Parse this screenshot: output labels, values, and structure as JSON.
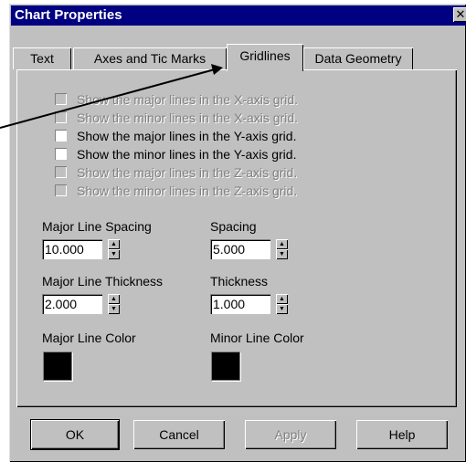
{
  "window": {
    "title": "Chart Properties",
    "close_glyph": "✕"
  },
  "tabs": [
    {
      "label": "Text",
      "active": false
    },
    {
      "label": "Axes and Tic Marks",
      "active": false
    },
    {
      "label": "Gridlines",
      "active": true
    },
    {
      "label": "Data Geometry",
      "active": false
    }
  ],
  "checkboxes": [
    {
      "label": "Show the major lines in the X-axis grid.",
      "enabled": false,
      "checked": false
    },
    {
      "label": "Show the minor lines in the X-axis grid.",
      "enabled": false,
      "checked": false
    },
    {
      "label": "Show the major lines in the Y-axis grid.",
      "enabled": true,
      "checked": false
    },
    {
      "label": "Show the minor lines in the Y-axis grid.",
      "enabled": true,
      "checked": false
    },
    {
      "label": "Show the major lines in the Z-axis grid.",
      "enabled": false,
      "checked": false
    },
    {
      "label": "Show the minor lines in the Z-axis grid.",
      "enabled": false,
      "checked": false
    }
  ],
  "fields": {
    "major_spacing": {
      "label": "Major Line Spacing",
      "value": "10.000"
    },
    "spacing": {
      "label": "Spacing",
      "value": "5.000"
    },
    "major_thickness": {
      "label": "Major Line Thickness",
      "value": "2.000"
    },
    "thickness": {
      "label": "Thickness",
      "value": "1.000"
    },
    "major_color": {
      "label": "Major Line Color",
      "color": "#000000"
    },
    "minor_color": {
      "label": "Minor Line Color",
      "color": "#000000"
    }
  },
  "buttons": {
    "ok": "OK",
    "cancel": "Cancel",
    "apply": "Apply",
    "help": "Help"
  },
  "colors": {
    "titlebar": "#000080",
    "face": "#c0c0c0"
  }
}
